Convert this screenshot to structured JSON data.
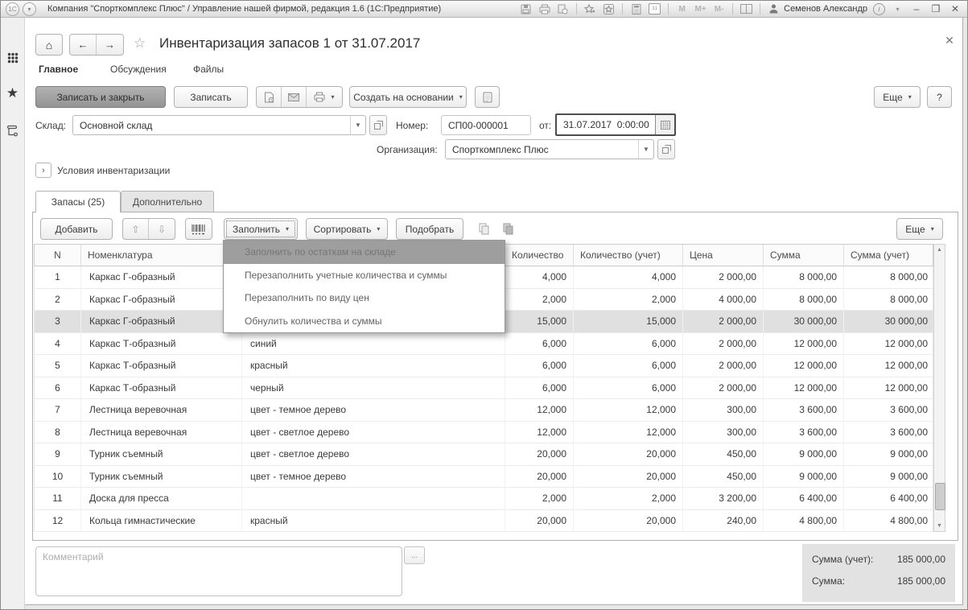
{
  "window": {
    "title": "Компания \"Спорткомплекс Плюс\" / Управление нашей фирмой, редакция 1.6  (1С:Предприятие)",
    "user": "Семенов Александр",
    "memory_buttons": [
      "M",
      "M+",
      "M-"
    ]
  },
  "header": {
    "title": "Инвентаризация запасов 1 от 31.07.2017",
    "menu": [
      "Главное",
      "Обсуждения",
      "Файлы"
    ]
  },
  "toolbar": {
    "save_close": "Записать и закрыть",
    "save": "Записать",
    "create_based_on": "Создать на основании",
    "more": "Еще",
    "help": "?"
  },
  "fields": {
    "warehouse_label": "Склад:",
    "warehouse_value": "Основной склад",
    "number_label": "Номер:",
    "number_value": "СП00-000001",
    "date_label": "от:",
    "date_value": "31.07.2017  0:00:00",
    "org_label": "Организация:",
    "org_value": "Спорткомплекс Плюс"
  },
  "conditions_label": "Условия инвентаризации",
  "tabs": [
    {
      "label": "Запасы (25)"
    },
    {
      "label": "Дополнительно"
    }
  ],
  "panel_toolbar": {
    "add": "Добавить",
    "fill": "Заполнить",
    "sort": "Сортировать",
    "pick": "Подобрать",
    "more": "Еще"
  },
  "dropdown": {
    "highlighted_index": 0,
    "items": [
      "Заполнить по остаткам на складе",
      "Перезаполнить учетные количества и суммы",
      "Перезаполнить по виду цен",
      "Обнулить количества и суммы"
    ]
  },
  "table": {
    "columns": [
      "N",
      "Номенклатура",
      "",
      "Количество",
      "Количество (учет)",
      "Цена",
      "Сумма",
      "Сумма (учет)"
    ],
    "selected_row": 3,
    "rows": [
      {
        "n": "1",
        "name": "Каркас Г-образный",
        "char": "",
        "qty": "4,000",
        "qty_acc": "4,000",
        "price": "2 000,00",
        "sum": "8 000,00",
        "sum_acc": "8 000,00"
      },
      {
        "n": "2",
        "name": "Каркас Г-образный",
        "char": "",
        "qty": "2,000",
        "qty_acc": "2,000",
        "price": "4 000,00",
        "sum": "8 000,00",
        "sum_acc": "8 000,00"
      },
      {
        "n": "3",
        "name": "Каркас Г-образный",
        "char": "",
        "qty": "15,000",
        "qty_acc": "15,000",
        "price": "2 000,00",
        "sum": "30 000,00",
        "sum_acc": "30 000,00"
      },
      {
        "n": "4",
        "name": "Каркас Т-образный",
        "char": "синий",
        "qty": "6,000",
        "qty_acc": "6,000",
        "price": "2 000,00",
        "sum": "12 000,00",
        "sum_acc": "12 000,00"
      },
      {
        "n": "5",
        "name": "Каркас Т-образный",
        "char": "красный",
        "qty": "6,000",
        "qty_acc": "6,000",
        "price": "2 000,00",
        "sum": "12 000,00",
        "sum_acc": "12 000,00"
      },
      {
        "n": "6",
        "name": "Каркас Т-образный",
        "char": "черный",
        "qty": "6,000",
        "qty_acc": "6,000",
        "price": "2 000,00",
        "sum": "12 000,00",
        "sum_acc": "12 000,00"
      },
      {
        "n": "7",
        "name": "Лестница веревочная",
        "char": "цвет - темное дерево",
        "qty": "12,000",
        "qty_acc": "12,000",
        "price": "300,00",
        "sum": "3 600,00",
        "sum_acc": "3 600,00"
      },
      {
        "n": "8",
        "name": "Лестница веревочная",
        "char": "цвет - светлое дерево",
        "qty": "12,000",
        "qty_acc": "12,000",
        "price": "300,00",
        "sum": "3 600,00",
        "sum_acc": "3 600,00"
      },
      {
        "n": "9",
        "name": "Турник съемный",
        "char": "цвет - светлое дерево",
        "qty": "20,000",
        "qty_acc": "20,000",
        "price": "450,00",
        "sum": "9 000,00",
        "sum_acc": "9 000,00"
      },
      {
        "n": "10",
        "name": "Турник съемный",
        "char": "цвет - темное дерево",
        "qty": "20,000",
        "qty_acc": "20,000",
        "price": "450,00",
        "sum": "9 000,00",
        "sum_acc": "9 000,00"
      },
      {
        "n": "11",
        "name": "Доска для пресса",
        "char": "",
        "qty": "2,000",
        "qty_acc": "2,000",
        "price": "3 200,00",
        "sum": "6 400,00",
        "sum_acc": "6 400,00"
      },
      {
        "n": "12",
        "name": "Кольца гимнастические",
        "char": "красный",
        "qty": "20,000",
        "qty_acc": "20,000",
        "price": "240,00",
        "sum": "4 800,00",
        "sum_acc": "4 800,00"
      }
    ]
  },
  "footer": {
    "comment_placeholder": "Комментарий",
    "dots": "...",
    "sum_acc_label": "Сумма (учет):",
    "sum_acc_value": "185 000,00",
    "sum_label": "Сумма:",
    "sum_value": "185 000,00"
  }
}
